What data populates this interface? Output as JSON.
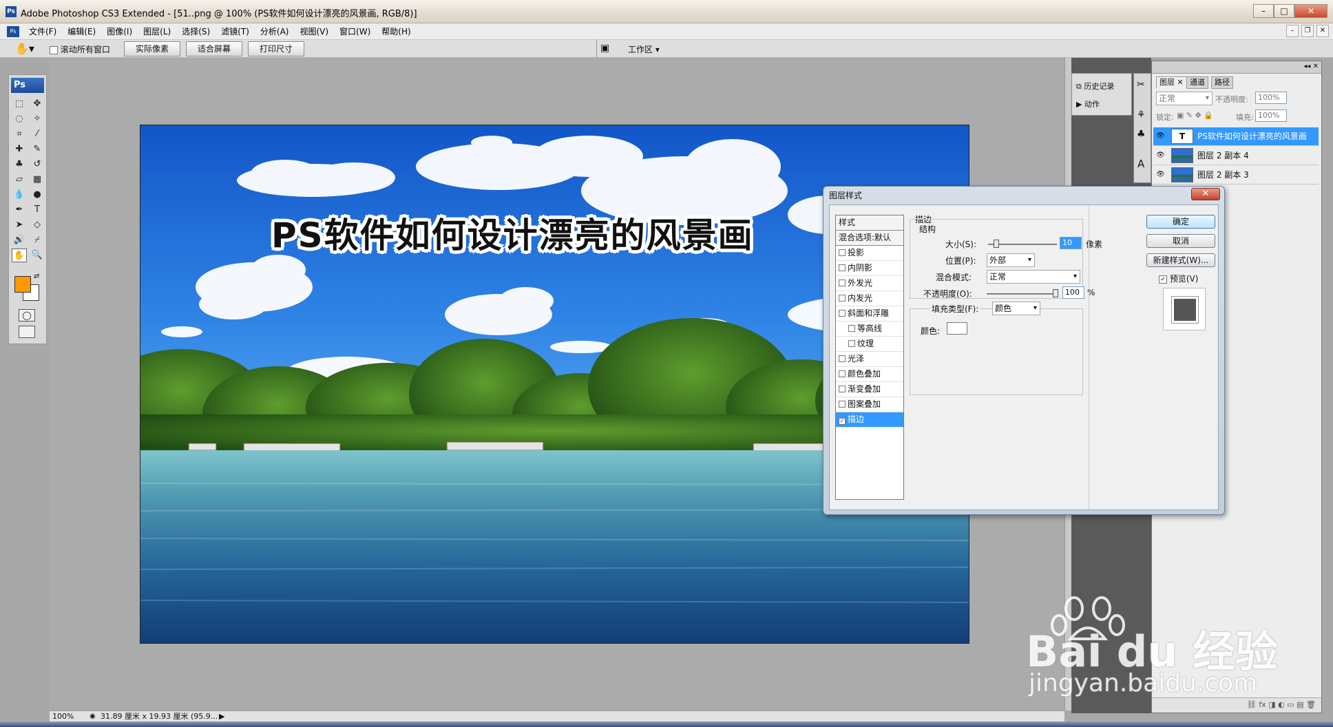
{
  "window": {
    "title": "Adobe Photoshop CS3 Extended - [51..png @ 100% (PS软件如何设计漂亮的风景画, RGB/8)]",
    "app_icon_label": "Ps",
    "minimize": "–",
    "maximize": "□",
    "close": "✕"
  },
  "menu": {
    "items": [
      "文件(F)",
      "编辑(E)",
      "图像(I)",
      "图层(L)",
      "选择(S)",
      "滤镜(T)",
      "分析(A)",
      "视图(V)",
      "窗口(W)",
      "帮助(H)"
    ]
  },
  "options": {
    "scroll_all_windows": "滚动所有窗口",
    "actual_pixels": "实际像素",
    "fit_screen": "适合屏幕",
    "print_size": "打印尺寸",
    "workspace": "工作区 ▾"
  },
  "toolbox": {
    "logo": "Ps",
    "foreground_color": "#ff9900",
    "background_color": "#ffffff"
  },
  "canvas": {
    "headline": "PS软件如何设计漂亮的风景画"
  },
  "status": {
    "zoom": "100%",
    "doc_size": "31.89 厘米 x 19.93 厘米 (95.9..."
  },
  "history_panel": {
    "history": "历史记录",
    "actions": "动作"
  },
  "layers_panel": {
    "tabs": [
      "图层",
      "通道",
      "路径"
    ],
    "blend_mode": "正常",
    "opacity_label": "不透明度:",
    "opacity_value": "100%",
    "lock_label": "锁定:",
    "fill_label": "填充:",
    "fill_value": "100%",
    "layers": [
      {
        "name": "PS软件如何设计漂亮的风景画",
        "type": "text",
        "selected": true
      },
      {
        "name": "图层 2 副本 4",
        "type": "image",
        "selected": false
      },
      {
        "name": "图层 2 副本 3",
        "type": "image",
        "selected": false
      }
    ]
  },
  "dialog": {
    "title": "图层样式",
    "styles_header": "样式",
    "blend_options": "混合选项:默认",
    "styles": [
      {
        "label": "投影",
        "checked": false
      },
      {
        "label": "内阴影",
        "checked": false
      },
      {
        "label": "外发光",
        "checked": false
      },
      {
        "label": "内发光",
        "checked": false
      },
      {
        "label": "斜面和浮雕",
        "checked": false
      },
      {
        "label": "等高线",
        "checked": false,
        "indent": true
      },
      {
        "label": "纹理",
        "checked": false,
        "indent": true
      },
      {
        "label": "光泽",
        "checked": false
      },
      {
        "label": "颜色叠加",
        "checked": false
      },
      {
        "label": "渐变叠加",
        "checked": false
      },
      {
        "label": "图案叠加",
        "checked": false
      },
      {
        "label": "描边",
        "checked": true,
        "selected": true
      }
    ],
    "section_title": "描边",
    "structure_title": "结构",
    "size_label": "大小(S):",
    "size_value": "10",
    "size_unit": "像素",
    "position_label": "位置(P):",
    "position_value": "外部",
    "blend_label": "混合模式:",
    "blend_value": "正常",
    "opacity_label": "不透明度(O):",
    "opacity_value": "100",
    "opacity_unit": "%",
    "fill_type_label": "填充类型(F):",
    "fill_type_value": "颜色",
    "color_label": "颜色:",
    "stroke_color": "#ffffff",
    "ok": "确定",
    "cancel": "取消",
    "new_style": "新建样式(W)...",
    "preview": "预览(V)",
    "preview_checked": true
  },
  "watermark": {
    "brand": "Bai  du 经验",
    "url": "jingyan.baidu.com"
  }
}
